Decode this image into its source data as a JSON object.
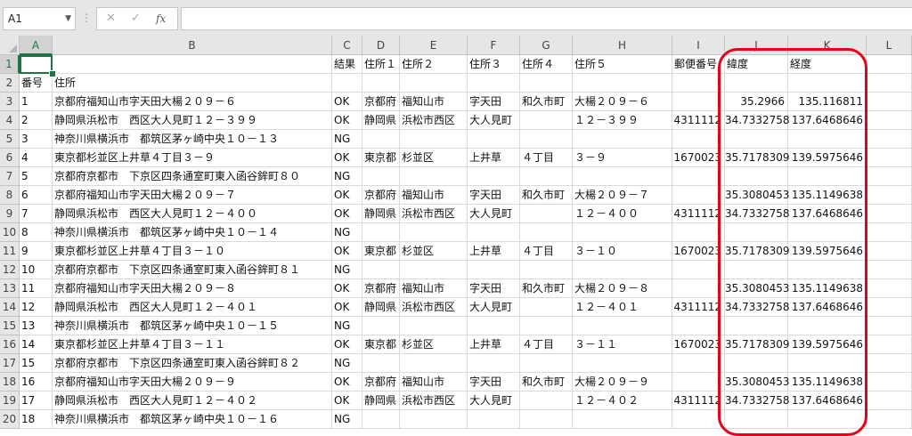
{
  "formula_bar": {
    "name_box": "A1",
    "name_box_dropdown_icon": "chevron-down-icon",
    "more_icon": "vertical-dots-icon",
    "cancel_icon": "close-icon",
    "enter_icon": "check-icon",
    "function_label": "fx",
    "formula": ""
  },
  "columns": [
    "A",
    "B",
    "C",
    "D",
    "E",
    "F",
    "G",
    "H",
    "I",
    "J",
    "K",
    "L"
  ],
  "selected_cell": "A1",
  "rows": [
    {
      "num": "1",
      "cells": [
        "",
        "",
        "結果",
        "住所１",
        "住所２",
        "住所３",
        "住所４",
        "住所５",
        "郵便番号",
        "緯度",
        "経度",
        ""
      ]
    },
    {
      "num": "2",
      "cells": [
        "番号",
        "住所",
        "",
        "",
        "",
        "",
        "",
        "",
        "",
        "",
        "",
        ""
      ]
    },
    {
      "num": "3",
      "cells": [
        "1",
        "京都府福知山市字天田大楊２０９－６",
        "OK",
        "京都府",
        "福知山市",
        "字天田",
        "和久市町",
        "大楊２０９－６",
        "",
        "35.2966",
        "135.116811",
        ""
      ]
    },
    {
      "num": "4",
      "cells": [
        "2",
        "静岡県浜松市　西区大人見町１２－３９９",
        "OK",
        "静岡県",
        "浜松市西区",
        "大人見町",
        "",
        "１２－３９９",
        "4311112",
        "34.7332758",
        "137.6468646",
        ""
      ]
    },
    {
      "num": "5",
      "cells": [
        "3",
        "神奈川県横浜市　都筑区茅ヶ崎中央１０－１３",
        "NG",
        "",
        "",
        "",
        "",
        "",
        "",
        "",
        "",
        ""
      ]
    },
    {
      "num": "6",
      "cells": [
        "4",
        "東京都杉並区上井草４丁目３－９",
        "OK",
        "東京都",
        "杉並区",
        "上井草",
        "４丁目",
        "３－９",
        "1670023",
        "35.7178309",
        "139.5975646",
        ""
      ]
    },
    {
      "num": "7",
      "cells": [
        "5",
        "京都府京都市　下京区四条通室町東入函谷鉾町８０",
        "NG",
        "",
        "",
        "",
        "",
        "",
        "",
        "",
        "",
        ""
      ]
    },
    {
      "num": "8",
      "cells": [
        "6",
        "京都府福知山市字天田大楊２０９－７",
        "OK",
        "京都府",
        "福知山市",
        "字天田",
        "和久市町",
        "大楊２０９－７",
        "",
        "35.3080453",
        "135.1149638",
        ""
      ]
    },
    {
      "num": "9",
      "cells": [
        "7",
        "静岡県浜松市　西区大人見町１２－４００",
        "OK",
        "静岡県",
        "浜松市西区",
        "大人見町",
        "",
        "１２－４００",
        "4311112",
        "34.7332758",
        "137.6468646",
        ""
      ]
    },
    {
      "num": "10",
      "cells": [
        "8",
        "神奈川県横浜市　都筑区茅ヶ崎中央１０－１４",
        "NG",
        "",
        "",
        "",
        "",
        "",
        "",
        "",
        "",
        ""
      ]
    },
    {
      "num": "11",
      "cells": [
        "9",
        "東京都杉並区上井草４丁目３－１０",
        "OK",
        "東京都",
        "杉並区",
        "上井草",
        "４丁目",
        "３－１０",
        "1670023",
        "35.7178309",
        "139.5975646",
        ""
      ]
    },
    {
      "num": "12",
      "cells": [
        "10",
        "京都府京都市　下京区四条通室町東入函谷鉾町８１",
        "NG",
        "",
        "",
        "",
        "",
        "",
        "",
        "",
        "",
        ""
      ]
    },
    {
      "num": "13",
      "cells": [
        "11",
        "京都府福知山市字天田大楊２０９－８",
        "OK",
        "京都府",
        "福知山市",
        "字天田",
        "和久市町",
        "大楊２０９－８",
        "",
        "35.3080453",
        "135.1149638",
        ""
      ]
    },
    {
      "num": "14",
      "cells": [
        "12",
        "静岡県浜松市　西区大人見町１２－４０１",
        "OK",
        "静岡県",
        "浜松市西区",
        "大人見町",
        "",
        "１２－４０１",
        "4311112",
        "34.7332758",
        "137.6468646",
        ""
      ]
    },
    {
      "num": "15",
      "cells": [
        "13",
        "神奈川県横浜市　都筑区茅ヶ崎中央１０－１５",
        "NG",
        "",
        "",
        "",
        "",
        "",
        "",
        "",
        "",
        ""
      ]
    },
    {
      "num": "16",
      "cells": [
        "14",
        "東京都杉並区上井草４丁目３－１１",
        "OK",
        "東京都",
        "杉並区",
        "上井草",
        "４丁目",
        "３－１１",
        "1670023",
        "35.7178309",
        "139.5975646",
        ""
      ]
    },
    {
      "num": "17",
      "cells": [
        "15",
        "京都府京都市　下京区四条通室町東入函谷鉾町８２",
        "NG",
        "",
        "",
        "",
        "",
        "",
        "",
        "",
        "",
        ""
      ]
    },
    {
      "num": "18",
      "cells": [
        "16",
        "京都府福知山市字天田大楊２０９－９",
        "OK",
        "京都府",
        "福知山市",
        "字天田",
        "和久市町",
        "大楊２０９－９",
        "",
        "35.3080453",
        "135.1149638",
        ""
      ]
    },
    {
      "num": "19",
      "cells": [
        "17",
        "静岡県浜松市　西区大人見町１２－４０２",
        "OK",
        "静岡県",
        "浜松市西区",
        "大人見町",
        "",
        "１２－４０２",
        "4311112",
        "34.7332758",
        "137.6468646",
        ""
      ]
    },
    {
      "num": "20",
      "cells": [
        "18",
        "神奈川県横浜市　都筑区茅ヶ崎中央１０－１６",
        "NG",
        "",
        "",
        "",
        "",
        "",
        "",
        "",
        "",
        ""
      ]
    }
  ],
  "highlight": {
    "color": "#e5001c",
    "note_icon": "red-rounded-rectangle"
  },
  "colors": {
    "accent": "#217346",
    "header_bg": "#e6e6e6",
    "gridline": "#dadada"
  }
}
